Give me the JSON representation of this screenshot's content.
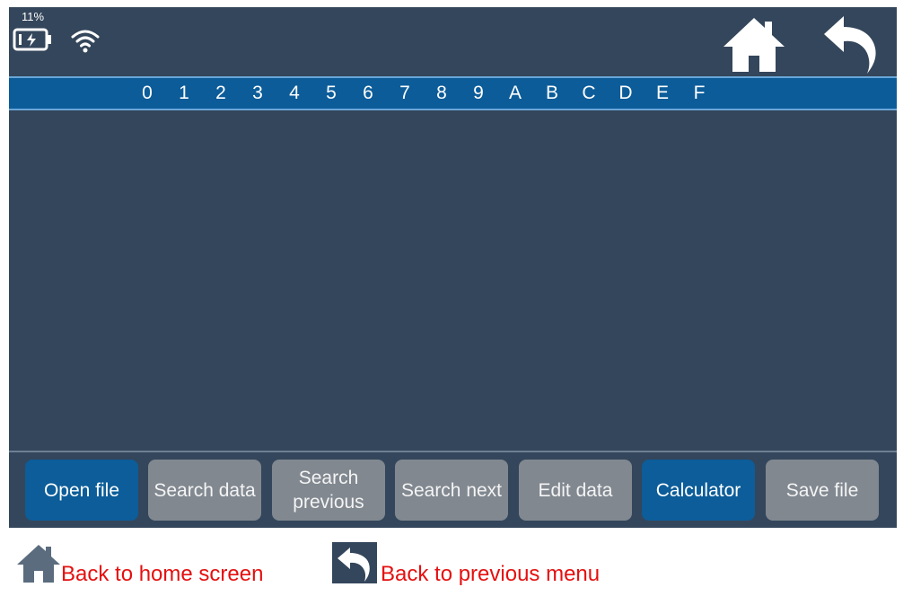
{
  "status": {
    "battery_percent": "11%",
    "battery_icon": "battery-charging-icon",
    "wifi_icon": "wifi-icon"
  },
  "nav": {
    "home_icon": "home-icon",
    "back_icon": "back-arrow-icon"
  },
  "hex_columns": [
    "0",
    "1",
    "2",
    "3",
    "4",
    "5",
    "6",
    "7",
    "8",
    "9",
    "A",
    "B",
    "C",
    "D",
    "E",
    "F"
  ],
  "buttons": [
    {
      "label": "Open file",
      "state": "active"
    },
    {
      "label": "Search data",
      "state": "disabled"
    },
    {
      "label": "Search previous",
      "state": "disabled"
    },
    {
      "label": "Search next",
      "state": "disabled"
    },
    {
      "label": "Edit data",
      "state": "disabled"
    },
    {
      "label": "Calculator",
      "state": "active"
    },
    {
      "label": "Save file",
      "state": "disabled"
    }
  ],
  "legend": {
    "home_text": "Back to home screen",
    "back_text": "Back to previous menu"
  },
  "colors": {
    "screen_bg": "#34465b",
    "hex_bar": "#0c5c99",
    "button_active": "#0c5d99",
    "button_disabled": "#818890",
    "legend_text": "#e50f0f"
  }
}
